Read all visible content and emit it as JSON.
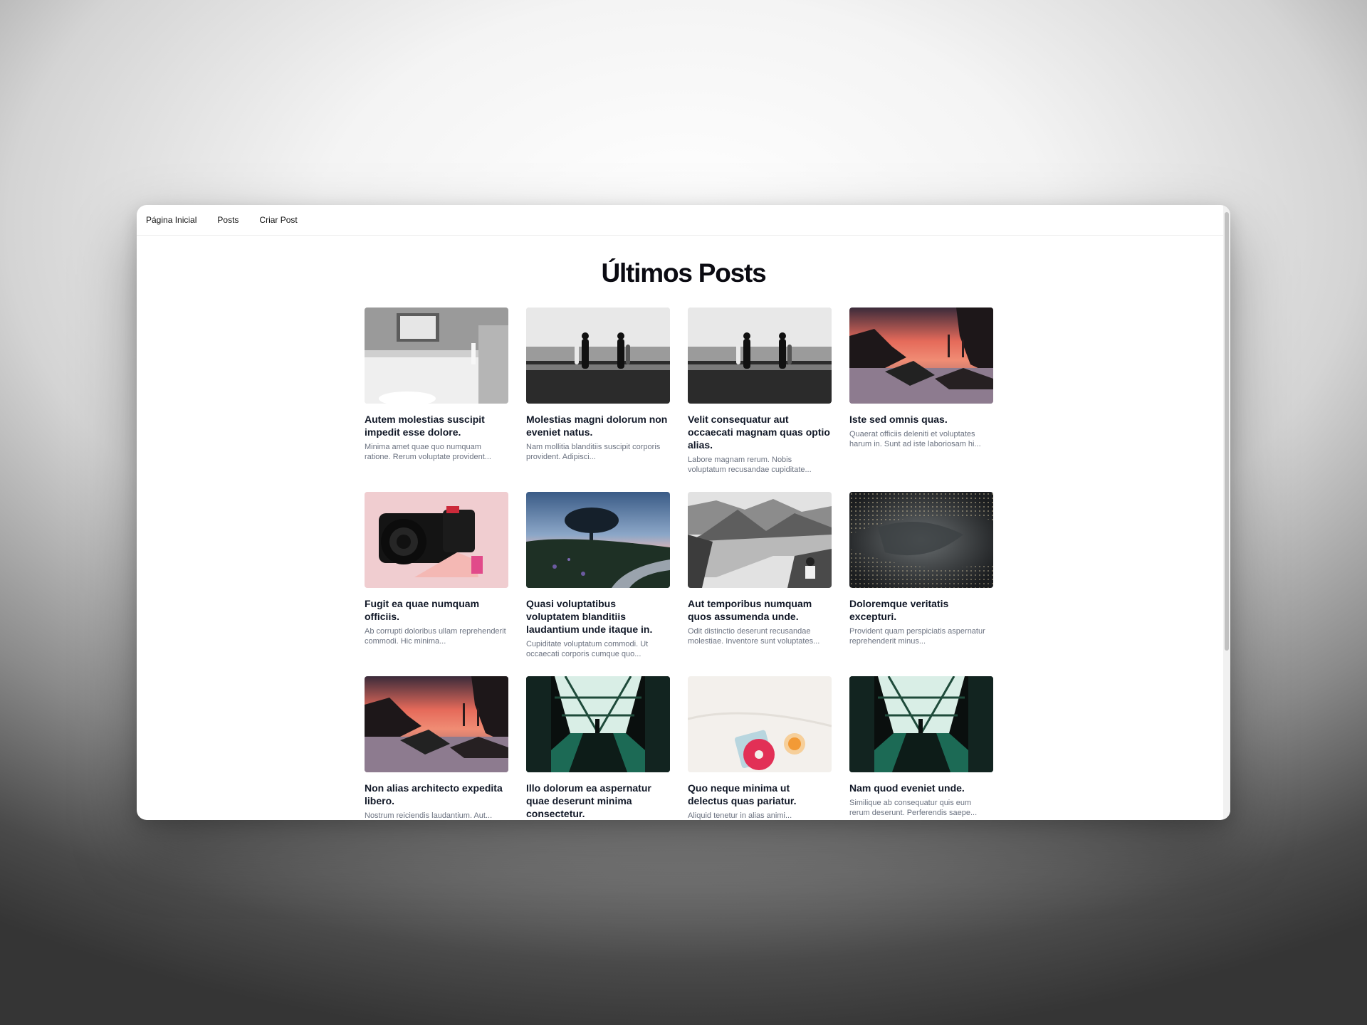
{
  "nav": {
    "home": "Página Inicial",
    "posts": "Posts",
    "create": "Criar Post"
  },
  "page": {
    "title": "Últimos Posts"
  },
  "posts": [
    {
      "title": "Autem molestias suscipit impedit esse dolore.",
      "excerpt": "Minima amet quae quo numquam ratione. Rerum voluptate provident...",
      "image": "room-bw"
    },
    {
      "title": "Molestias magni dolorum non eveniet natus.",
      "excerpt": "Nam mollitia blanditiis suscipit corporis provident. Adipisci...",
      "image": "surfers-bw"
    },
    {
      "title": "Velit consequatur aut occaecati magnam quas optio alias.",
      "excerpt": "Labore magnam rerum. Nobis voluptatum recusandae cupiditate...",
      "image": "surfers-bw"
    },
    {
      "title": "Iste sed omnis quas.",
      "excerpt": "Quaerat officiis deleniti et voluptates harum in. Sunt ad iste laboriosam hi...",
      "image": "sunset-bridge"
    },
    {
      "title": "Fugit ea quae numquam officiis.",
      "excerpt": "Ab corrupti doloribus ullam reprehenderit commodi. Hic minima...",
      "image": "camera"
    },
    {
      "title": "Quasi voluptatibus voluptatem blanditiis laudantium unde itaque in.",
      "excerpt": "Cupiditate voluptatum commodi. Ut occaecati corporis cumque quo...",
      "image": "tree-dusk"
    },
    {
      "title": "Aut temporibus numquam quos assumenda unde.",
      "excerpt": "Odit distinctio deserunt recusandae molestiae. Inventore sunt voluptates...",
      "image": "fjord-bw"
    },
    {
      "title": "Doloremque veritatis excepturi.",
      "excerpt": "Provident quam perspiciatis aspernatur reprehenderit minus...",
      "image": "abstract"
    },
    {
      "title": "Non alias architecto expedita libero.",
      "excerpt": "Nostrum reiciendis laudantium. Aut...",
      "image": "sunset-bridge"
    },
    {
      "title": "Illo dolorum ea aspernatur quae deserunt minima consectetur.",
      "excerpt": "",
      "image": "escalator"
    },
    {
      "title": "Quo neque minima ut delectus quas pariatur.",
      "excerpt": "Aliquid tenetur in alias animi...",
      "image": "donut"
    },
    {
      "title": "Nam quod eveniet unde.",
      "excerpt": "Similique ab consequatur quis eum rerum deserunt. Perferendis saepe...",
      "image": "escalator"
    }
  ]
}
